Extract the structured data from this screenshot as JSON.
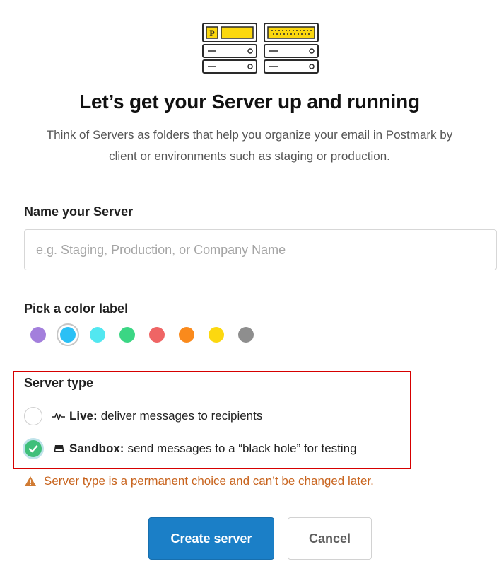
{
  "header": {
    "title": "Let’s get your Server up and running",
    "subtitle": "Think of Servers as folders that help you organize your email in Postmark by client or environments such as staging or production."
  },
  "illustration": {
    "icon": "servers-illustration-icon",
    "badge_letter": "P"
  },
  "name_field": {
    "label": "Name your Server",
    "placeholder": "e.g. Staging, Production, or Company Name",
    "value": ""
  },
  "color_label": {
    "label": "Pick a color label",
    "swatches": [
      {
        "name": "purple",
        "color": "#a37fdc",
        "selected": false
      },
      {
        "name": "blue",
        "color": "#2bc0f5",
        "selected": true
      },
      {
        "name": "cyan",
        "color": "#52e7f0",
        "selected": false
      },
      {
        "name": "green",
        "color": "#3bd684",
        "selected": false
      },
      {
        "name": "red",
        "color": "#ef6565",
        "selected": false
      },
      {
        "name": "orange",
        "color": "#fa8a1c",
        "selected": false
      },
      {
        "name": "yellow",
        "color": "#fcd80f",
        "selected": false
      },
      {
        "name": "gray",
        "color": "#8e8e8e",
        "selected": false
      }
    ]
  },
  "server_type": {
    "label": "Server type",
    "options": [
      {
        "icon": "activity-pulse-icon",
        "title": "Live:",
        "description": "deliver messages to recipients",
        "selected": false
      },
      {
        "icon": "inbox-tray-icon",
        "title": "Sandbox:",
        "description": "send messages to a “black hole” for testing",
        "selected": true
      }
    ],
    "warning": "Server type is a permanent choice and can’t be changed later.",
    "warning_icon": "warning-triangle-icon"
  },
  "actions": {
    "create_label": "Create server",
    "cancel_label": "Cancel"
  },
  "colors": {
    "primary_button": "#1b7fc7",
    "warning_text": "#c8641e",
    "selected_radio": "#3fbf7a",
    "highlight_box": "#d60000"
  }
}
